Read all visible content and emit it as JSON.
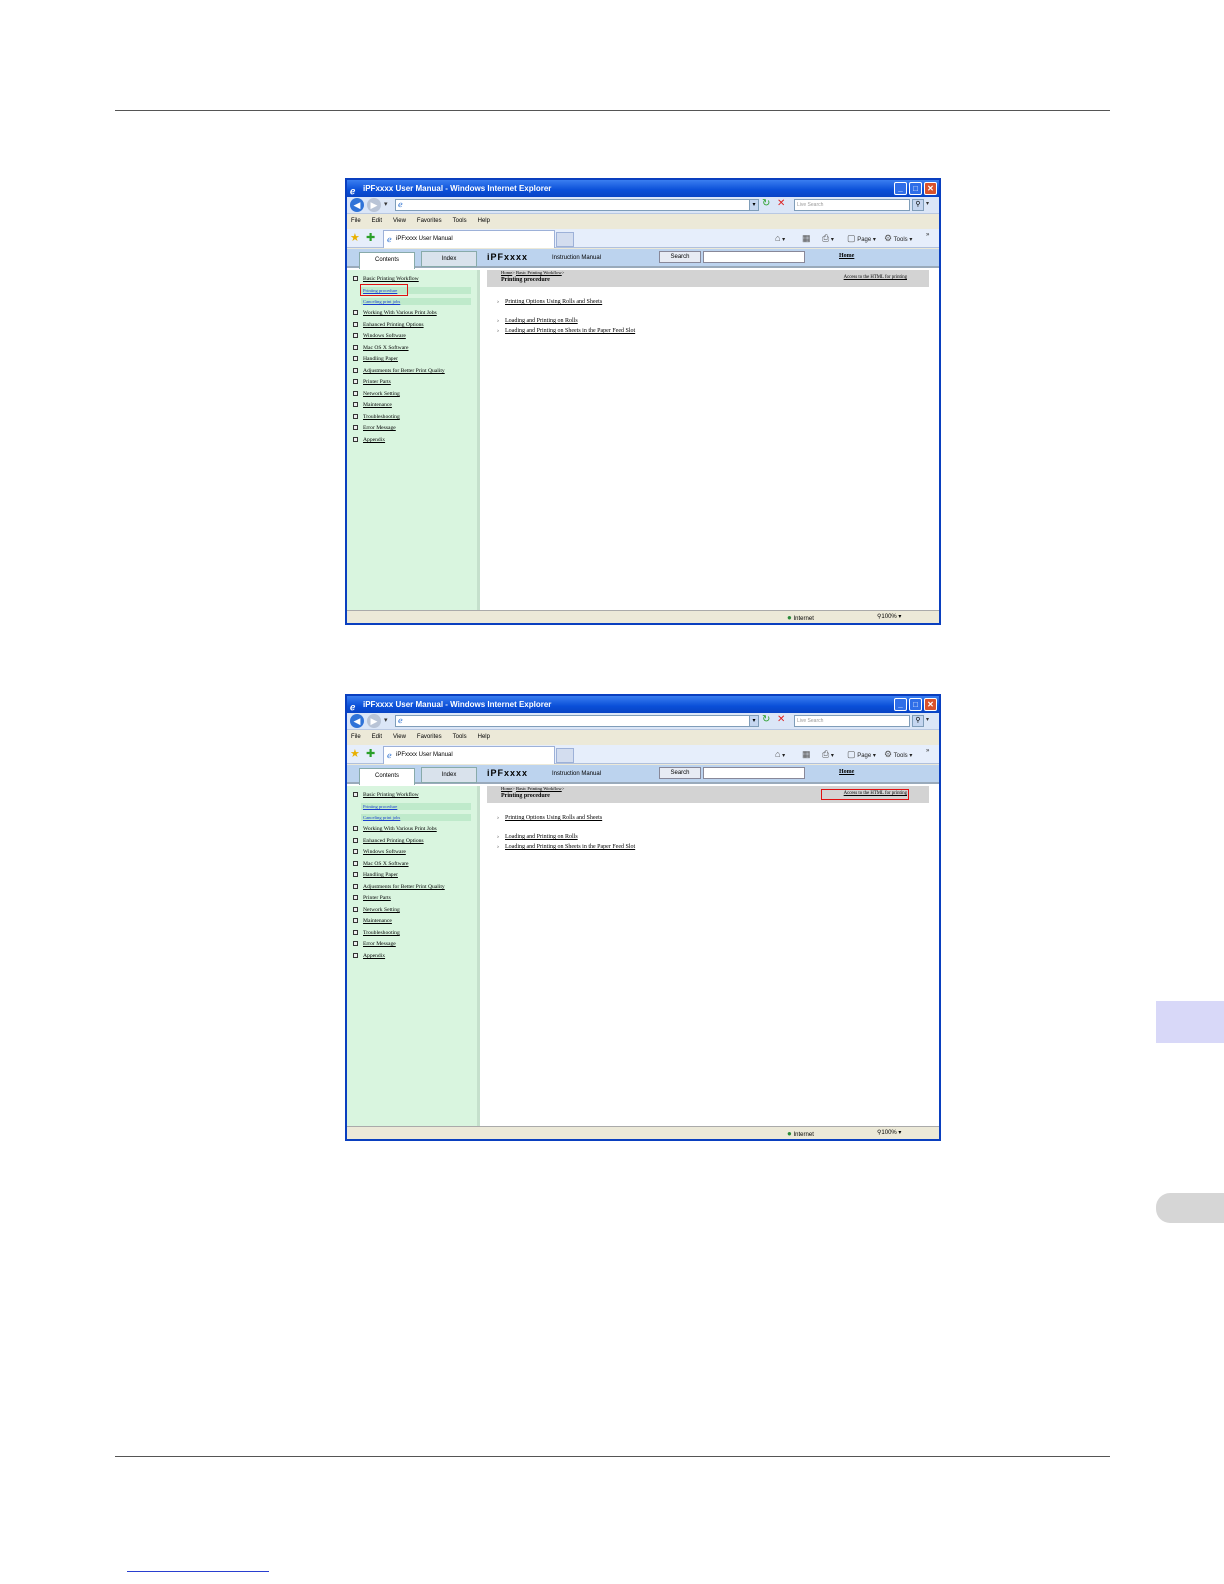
{
  "browser": {
    "title": "iPFxxxx User Manual - Windows Internet Explorer",
    "search_placeholder": "Live Search",
    "menu": [
      "File",
      "Edit",
      "View",
      "Favorites",
      "Tools",
      "Help"
    ],
    "tab_label": "iPFxxxx User Manual",
    "commands": {
      "page": "Page",
      "tools": "Tools"
    },
    "status_zone": "Internet",
    "zoom": "100%"
  },
  "help": {
    "tab_contents": "Contents",
    "tab_index": "Index",
    "brand": "iPFxxxx",
    "brand_sub": "Instruction Manual",
    "search_button": "Search",
    "home_link": "Home",
    "toc": [
      "Basic Printing Workflow",
      "Working With Various Print Jobs",
      "Enhanced Printing Options",
      "Windows Software",
      "Mac OS X Software",
      "Handling Paper",
      "Adjustments for Better Print Quality",
      "Printer Parts",
      "Network Setting",
      "Maintenance",
      "Troubleshooting",
      "Error Message",
      "Appendix"
    ],
    "toc_sub": [
      "Printing procedure",
      "Canceling print jobs"
    ],
    "crumb_home": "Home",
    "crumb_section": "Basic Printing Workflow",
    "crumb_sep": ">",
    "page_title": "Printing procedure",
    "print_link": "Access to the HTML for printing",
    "links": [
      "Printing Options Using Rolls and Sheets",
      "Loading and Printing on Rolls",
      "Loading and Printing on Sheets in the Paper Feed Slot"
    ]
  }
}
